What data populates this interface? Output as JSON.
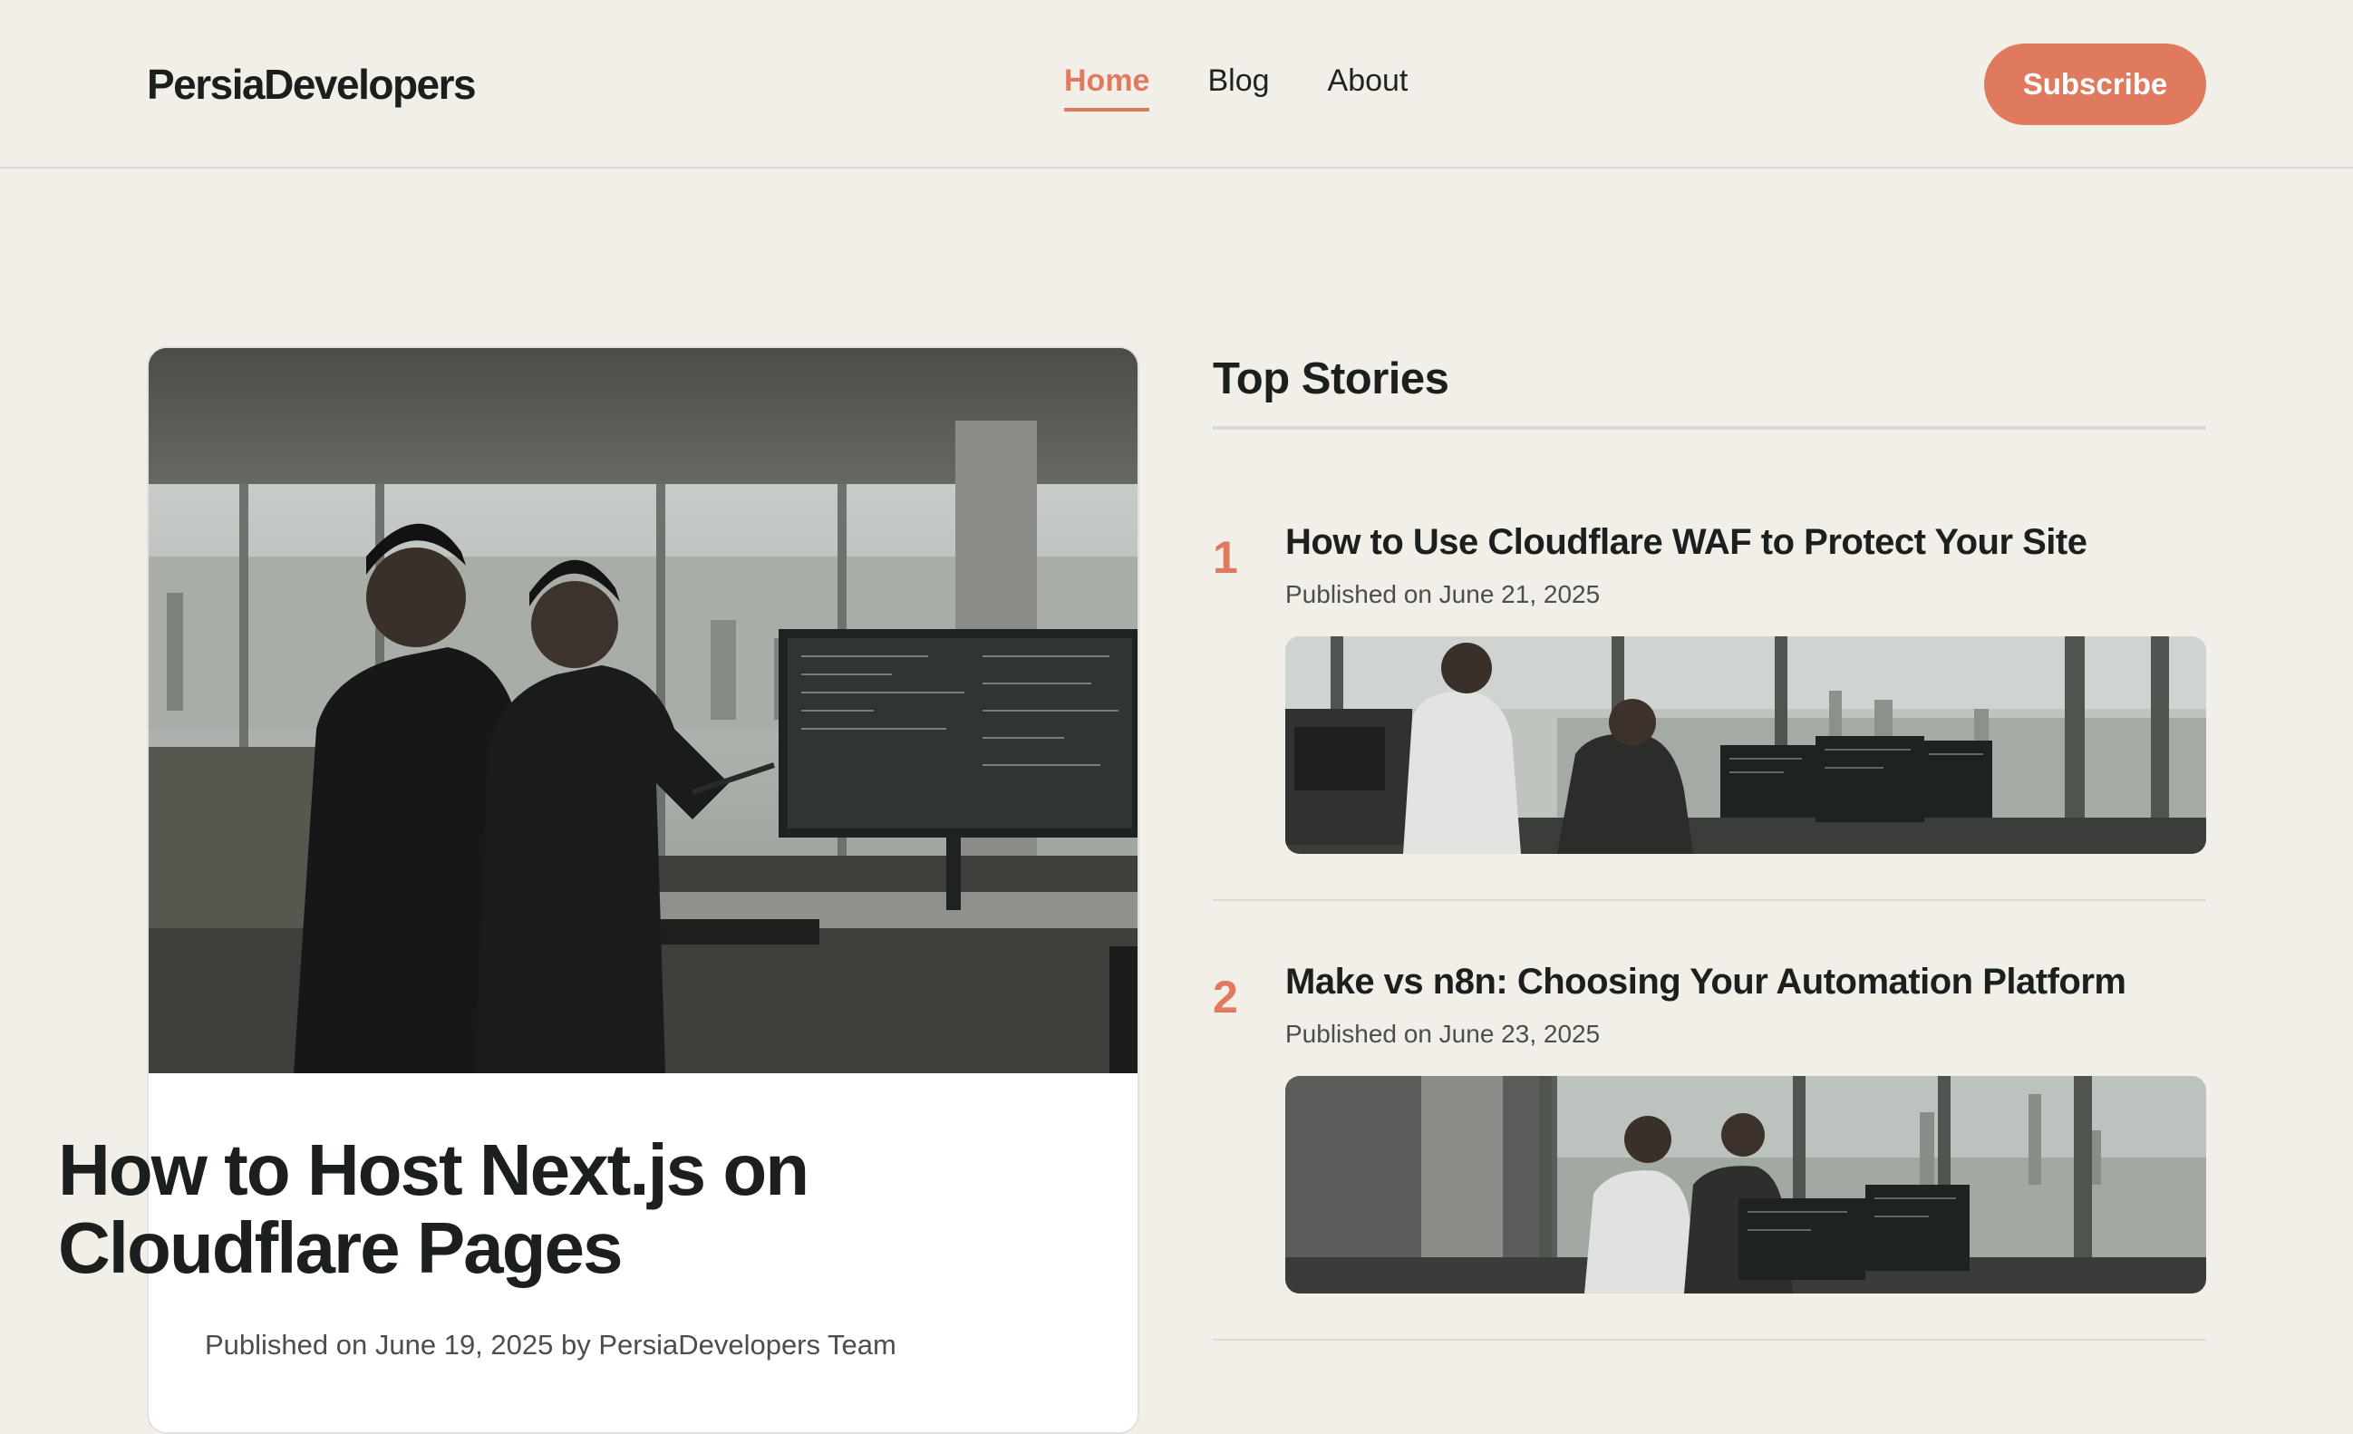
{
  "header": {
    "logo": "PersiaDevelopers",
    "nav": [
      {
        "label": "Home",
        "active": true
      },
      {
        "label": "Blog",
        "active": false
      },
      {
        "label": "About",
        "active": false
      }
    ],
    "subscribe_label": "Subscribe"
  },
  "featured": {
    "title": "How to Host Next.js on Cloudflare Pages",
    "meta": "Published on June 19, 2025 by PersiaDevelopers Team"
  },
  "top_stories": {
    "heading": "Top Stories",
    "items": [
      {
        "rank": "1",
        "title": "How to Use Cloudflare WAF to Protect Your Site",
        "meta": "Published on June 21, 2025"
      },
      {
        "rank": "2",
        "title": "Make vs n8n: Choosing Your Automation Platform",
        "meta": "Published on June 23, 2025"
      }
    ]
  },
  "colors": {
    "accent": "#e07a5f",
    "background": "#f2efe9"
  }
}
